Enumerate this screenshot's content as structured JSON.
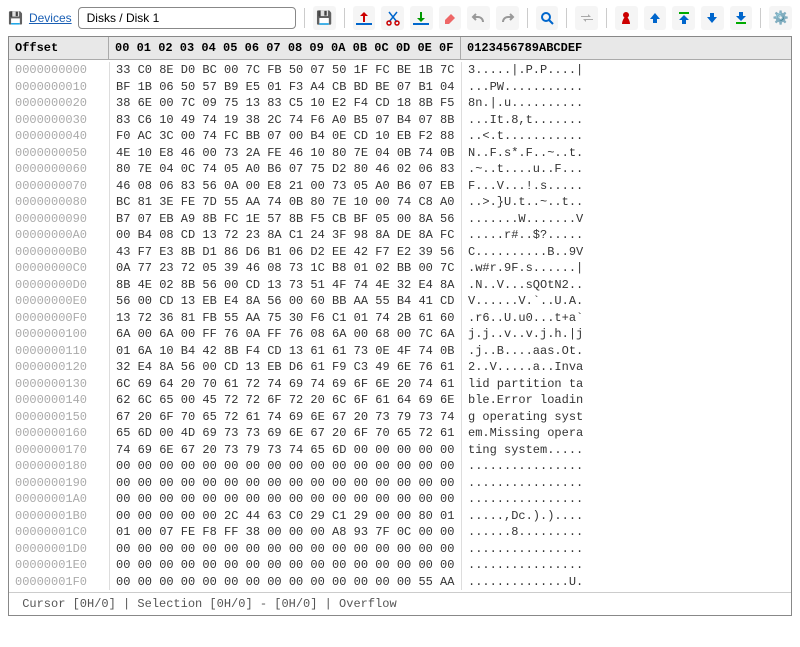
{
  "toolbar": {
    "devices_label": "Devices",
    "path": "Disks / Disk 1",
    "icons": {
      "save": "save-icon",
      "import": "import-icon",
      "cut": "cut-icon",
      "export": "export-icon",
      "erase": "erase-icon",
      "undo": "undo-icon",
      "redo": "redo-icon",
      "search": "search-icon",
      "goto": "goto-icon",
      "bookmark": "bookmark-icon",
      "up": "up-icon",
      "pageup": "pageup-icon",
      "down": "down-icon",
      "pagedown": "pagedown-icon",
      "settings": "settings-icon"
    }
  },
  "hex": {
    "header": {
      "offset": "Offset",
      "bytes": "00 01 02 03 04 05 06 07 08 09 0A 0B 0C 0D 0E 0F",
      "ascii": "0123456789ABCDEF"
    },
    "rows": [
      {
        "offset": "0000000000",
        "bytes": "33 C0 8E D0 BC 00 7C FB 50 07 50 1F FC BE 1B 7C",
        "ascii": "3.....|.P.P....|"
      },
      {
        "offset": "0000000010",
        "bytes": "BF 1B 06 50 57 B9 E5 01 F3 A4 CB BD BE 07 B1 04",
        "ascii": "...PW..........."
      },
      {
        "offset": "0000000020",
        "bytes": "38 6E 00 7C 09 75 13 83 C5 10 E2 F4 CD 18 8B F5",
        "ascii": "8n.|.u.........."
      },
      {
        "offset": "0000000030",
        "bytes": "83 C6 10 49 74 19 38 2C 74 F6 A0 B5 07 B4 07 8B",
        "ascii": "...It.8,t......."
      },
      {
        "offset": "0000000040",
        "bytes": "F0 AC 3C 00 74 FC BB 07 00 B4 0E CD 10 EB F2 88",
        "ascii": "..<.t..........."
      },
      {
        "offset": "0000000050",
        "bytes": "4E 10 E8 46 00 73 2A FE 46 10 80 7E 04 0B 74 0B",
        "ascii": "N..F.s*.F..~..t."
      },
      {
        "offset": "0000000060",
        "bytes": "80 7E 04 0C 74 05 A0 B6 07 75 D2 80 46 02 06 83",
        "ascii": ".~..t....u..F..."
      },
      {
        "offset": "0000000070",
        "bytes": "46 08 06 83 56 0A 00 E8 21 00 73 05 A0 B6 07 EB",
        "ascii": "F...V...!.s....."
      },
      {
        "offset": "0000000080",
        "bytes": "BC 81 3E FE 7D 55 AA 74 0B 80 7E 10 00 74 C8 A0",
        "ascii": "..>.}U.t..~..t.."
      },
      {
        "offset": "0000000090",
        "bytes": "B7 07 EB A9 8B FC 1E 57 8B F5 CB BF 05 00 8A 56",
        "ascii": ".......W.......V"
      },
      {
        "offset": "00000000A0",
        "bytes": "00 B4 08 CD 13 72 23 8A C1 24 3F 98 8A DE 8A FC",
        "ascii": ".....r#..$?....."
      },
      {
        "offset": "00000000B0",
        "bytes": "43 F7 E3 8B D1 86 D6 B1 06 D2 EE 42 F7 E2 39 56",
        "ascii": "C..........B..9V"
      },
      {
        "offset": "00000000C0",
        "bytes": "0A 77 23 72 05 39 46 08 73 1C B8 01 02 BB 00 7C",
        "ascii": ".w#r.9F.s......|"
      },
      {
        "offset": "00000000D0",
        "bytes": "8B 4E 02 8B 56 00 CD 13 73 51 4F 74 4E 32 E4 8A",
        "ascii": ".N..V...sQOtN2.."
      },
      {
        "offset": "00000000E0",
        "bytes": "56 00 CD 13 EB E4 8A 56 00 60 BB AA 55 B4 41 CD",
        "ascii": "V......V.`..U.A."
      },
      {
        "offset": "00000000F0",
        "bytes": "13 72 36 81 FB 55 AA 75 30 F6 C1 01 74 2B 61 60",
        "ascii": ".r6..U.u0...t+a`"
      },
      {
        "offset": "0000000100",
        "bytes": "6A 00 6A 00 FF 76 0A FF 76 08 6A 00 68 00 7C 6A",
        "ascii": "j.j..v..v.j.h.|j"
      },
      {
        "offset": "0000000110",
        "bytes": "01 6A 10 B4 42 8B F4 CD 13 61 61 73 0E 4F 74 0B",
        "ascii": ".j..B....aas.Ot."
      },
      {
        "offset": "0000000120",
        "bytes": "32 E4 8A 56 00 CD 13 EB D6 61 F9 C3 49 6E 76 61",
        "ascii": "2..V.....a..Inva"
      },
      {
        "offset": "0000000130",
        "bytes": "6C 69 64 20 70 61 72 74 69 74 69 6F 6E 20 74 61",
        "ascii": "lid partition ta"
      },
      {
        "offset": "0000000140",
        "bytes": "62 6C 65 00 45 72 72 6F 72 20 6C 6F 61 64 69 6E",
        "ascii": "ble.Error loadin"
      },
      {
        "offset": "0000000150",
        "bytes": "67 20 6F 70 65 72 61 74 69 6E 67 20 73 79 73 74",
        "ascii": "g operating syst"
      },
      {
        "offset": "0000000160",
        "bytes": "65 6D 00 4D 69 73 73 69 6E 67 20 6F 70 65 72 61",
        "ascii": "em.Missing opera"
      },
      {
        "offset": "0000000170",
        "bytes": "74 69 6E 67 20 73 79 73 74 65 6D 00 00 00 00 00",
        "ascii": "ting system....."
      },
      {
        "offset": "0000000180",
        "bytes": "00 00 00 00 00 00 00 00 00 00 00 00 00 00 00 00",
        "ascii": "................"
      },
      {
        "offset": "0000000190",
        "bytes": "00 00 00 00 00 00 00 00 00 00 00 00 00 00 00 00",
        "ascii": "................"
      },
      {
        "offset": "00000001A0",
        "bytes": "00 00 00 00 00 00 00 00 00 00 00 00 00 00 00 00",
        "ascii": "................"
      },
      {
        "offset": "00000001B0",
        "bytes": "00 00 00 00 00 2C 44 63 C0 29 C1 29 00 00 80 01",
        "ascii": ".....,Dc.).)...."
      },
      {
        "offset": "00000001C0",
        "bytes": "01 00 07 FE F8 FF 38 00 00 00 A8 93 7F 0C 00 00",
        "ascii": "......8........."
      },
      {
        "offset": "00000001D0",
        "bytes": "00 00 00 00 00 00 00 00 00 00 00 00 00 00 00 00",
        "ascii": "................"
      },
      {
        "offset": "00000001E0",
        "bytes": "00 00 00 00 00 00 00 00 00 00 00 00 00 00 00 00",
        "ascii": "................"
      },
      {
        "offset": "00000001F0",
        "bytes": "00 00 00 00 00 00 00 00 00 00 00 00 00 00 55 AA",
        "ascii": "..............U."
      }
    ]
  },
  "status": " Cursor [0H/0] | Selection [0H/0] - [0H/0] | Overflow"
}
